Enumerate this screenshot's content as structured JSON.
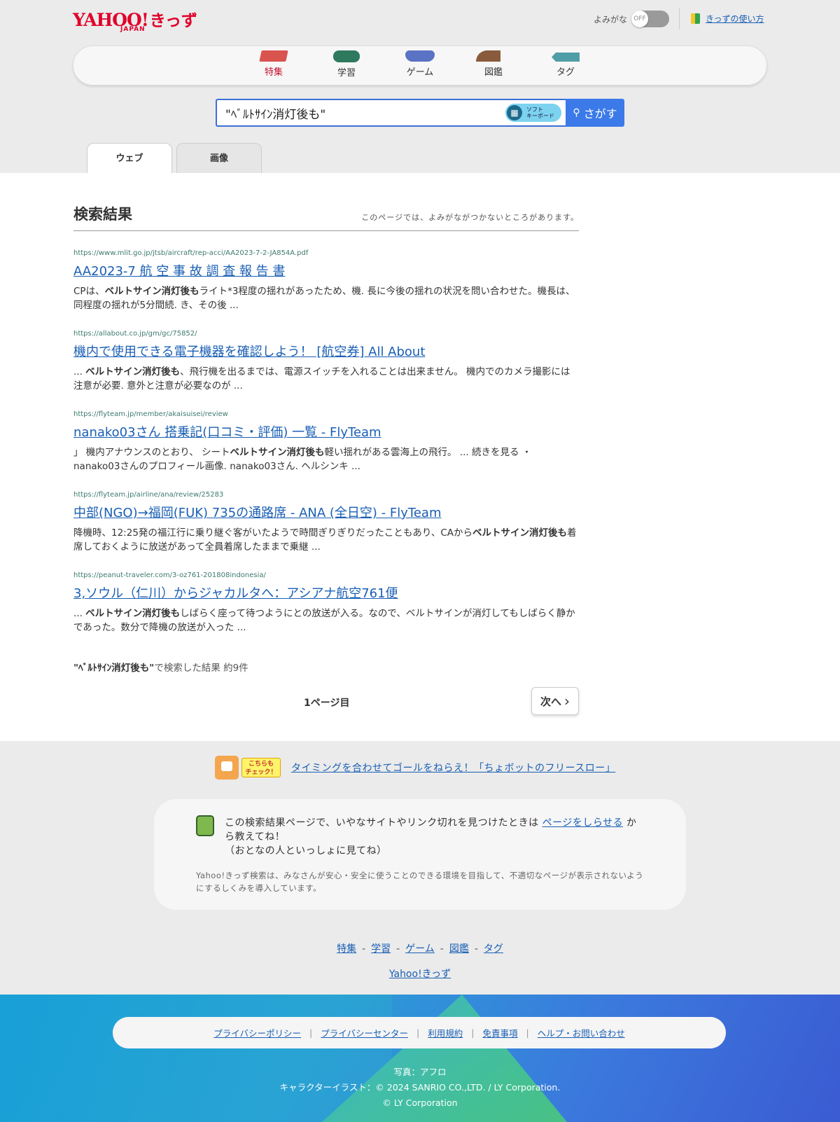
{
  "header": {
    "logo_yahoo": "YAHOO!",
    "logo_kids": "きっず",
    "logo_japan": "JAPAN",
    "yomigana_label": "よみがな",
    "toggle_state": "OFF",
    "howto_link": "きっずの使い方"
  },
  "categories": [
    {
      "label": "特集",
      "icon": "feature-icon"
    },
    {
      "label": "学習",
      "icon": "study-icon"
    },
    {
      "label": "ゲーム",
      "icon": "game-icon"
    },
    {
      "label": "図鑑",
      "icon": "encyclopedia-icon"
    },
    {
      "label": "タグ",
      "icon": "tag-icon"
    }
  ],
  "search": {
    "query": "\"ﾍﾞﾙﾄｻｲﾝ消灯後も\"",
    "soft_keyboard_line1": "ソフト",
    "soft_keyboard_line2": "キーボード",
    "button_label": "さがす"
  },
  "tabs": [
    {
      "label": "ウェブ",
      "active": true
    },
    {
      "label": "画像",
      "active": false
    }
  ],
  "results_header": {
    "title": "検索結果",
    "notice": "このページでは、よみがながつかないところがあります。"
  },
  "results": [
    {
      "url": "https://www.mlit.go.jp/jtsb/aircraft/rep-acci/AA2023-7-2-JA854A.pdf",
      "title": "AA2023-7 航 空 事 故 調 査 報 告 書",
      "snippet_pre": "CPは、",
      "snippet_bold": "ベルトサイン消灯後も",
      "snippet_post": "ライト*3程度の揺れがあったため、機. 長に今後の揺れの状況を問い合わせた。機長は、同程度の揺れが5分間続. き、その後 ..."
    },
    {
      "url": "https://allabout.co.jp/gm/gc/75852/",
      "title": "機内で使用できる電子機器を確認しよう！ [航空券] All About",
      "snippet_pre": "... ",
      "snippet_bold": "ベルトサイン消灯後も",
      "snippet_post": "、飛行機を出るまでは、電源スイッチを入れることは出来ません。 機内でのカメラ撮影には注意が必要. 意外と注意が必要なのが ..."
    },
    {
      "url": "https://flyteam.jp/member/akaisuisei/review",
      "title": "nanako03さん 搭乗記(口コミ・評価) 一覧 - FlyTeam",
      "snippet_pre": "」 機内アナウンスのとおり、 シート",
      "snippet_bold": "ベルトサイン消灯後も",
      "snippet_post": "軽い揺れがある雲海上の飛行。 ... 続きを見る ・ nanako03さんのプロフィール画像. nanako03さん. ヘルシンキ ..."
    },
    {
      "url": "https://flyteam.jp/airline/ana/review/25283",
      "title": "中部(NGO)→福岡(FUK) 735の通路席 - ANA (全日空) - FlyTeam",
      "snippet_pre": "降機時、12:25発の福江行に乗り継ぐ客がいたようで時間ぎりぎりだったこともあり、CAから",
      "snippet_bold": "ベルトサイン消灯後も",
      "snippet_post": "着席しておくように放送があって全員着席したままで乗継 ..."
    },
    {
      "url": "https://peanut-traveler.com/3-oz761-201808indonesia/",
      "title": "3,ソウル（仁川）からジャカルタへ：アシアナ航空761便",
      "snippet_pre": "... ",
      "snippet_bold": "ベルトサイン消灯後も",
      "snippet_post": "しばらく座って待つようにとの放送が入る。なので、ベルトサインが消灯してもしばらく静かであった。数分で降機の放送が入った ..."
    }
  ],
  "result_count": {
    "query": "\"ﾍﾞﾙﾄｻｲﾝ消灯後も\"",
    "text": "で検索した結果 約9件"
  },
  "pagination": {
    "current": "1ページ目",
    "next": "次へ"
  },
  "promo": {
    "badge_line1": "こちらも",
    "badge_line2": "チェック！",
    "link": "タイミングを合わせてゴールをねらえ！「ちょボットのフリースロー」"
  },
  "report": {
    "msg_pre": "この検索結果ページで、いやなサイトやリンク切れを見つけたときは",
    "msg_link": "ページをしらせる",
    "msg_post": "から教えてね！",
    "msg_note": "（おとなの人といっしょに見てね）",
    "fine": "Yahoo!きっず検索は、みなさんが安心・安全に使うことのできる環境を目指して、不適切なページが表示されないようにするしくみを導入しています。"
  },
  "footer_nav": [
    "特集",
    "学習",
    "ゲーム",
    "図鑑",
    "タグ"
  ],
  "footer_home": "Yahoo!きっず",
  "legal_links": [
    "プライバシーポリシー",
    "プライバシーセンター",
    "利用規約",
    "免責事項",
    "ヘルプ・お問い合わせ"
  ],
  "credits": {
    "photo": "写真：アフロ",
    "illust": "キャラクターイラスト：© 2024 SANRIO CO.,LTD. / LY Corporation.",
    "copyright": "© LY Corporation"
  }
}
